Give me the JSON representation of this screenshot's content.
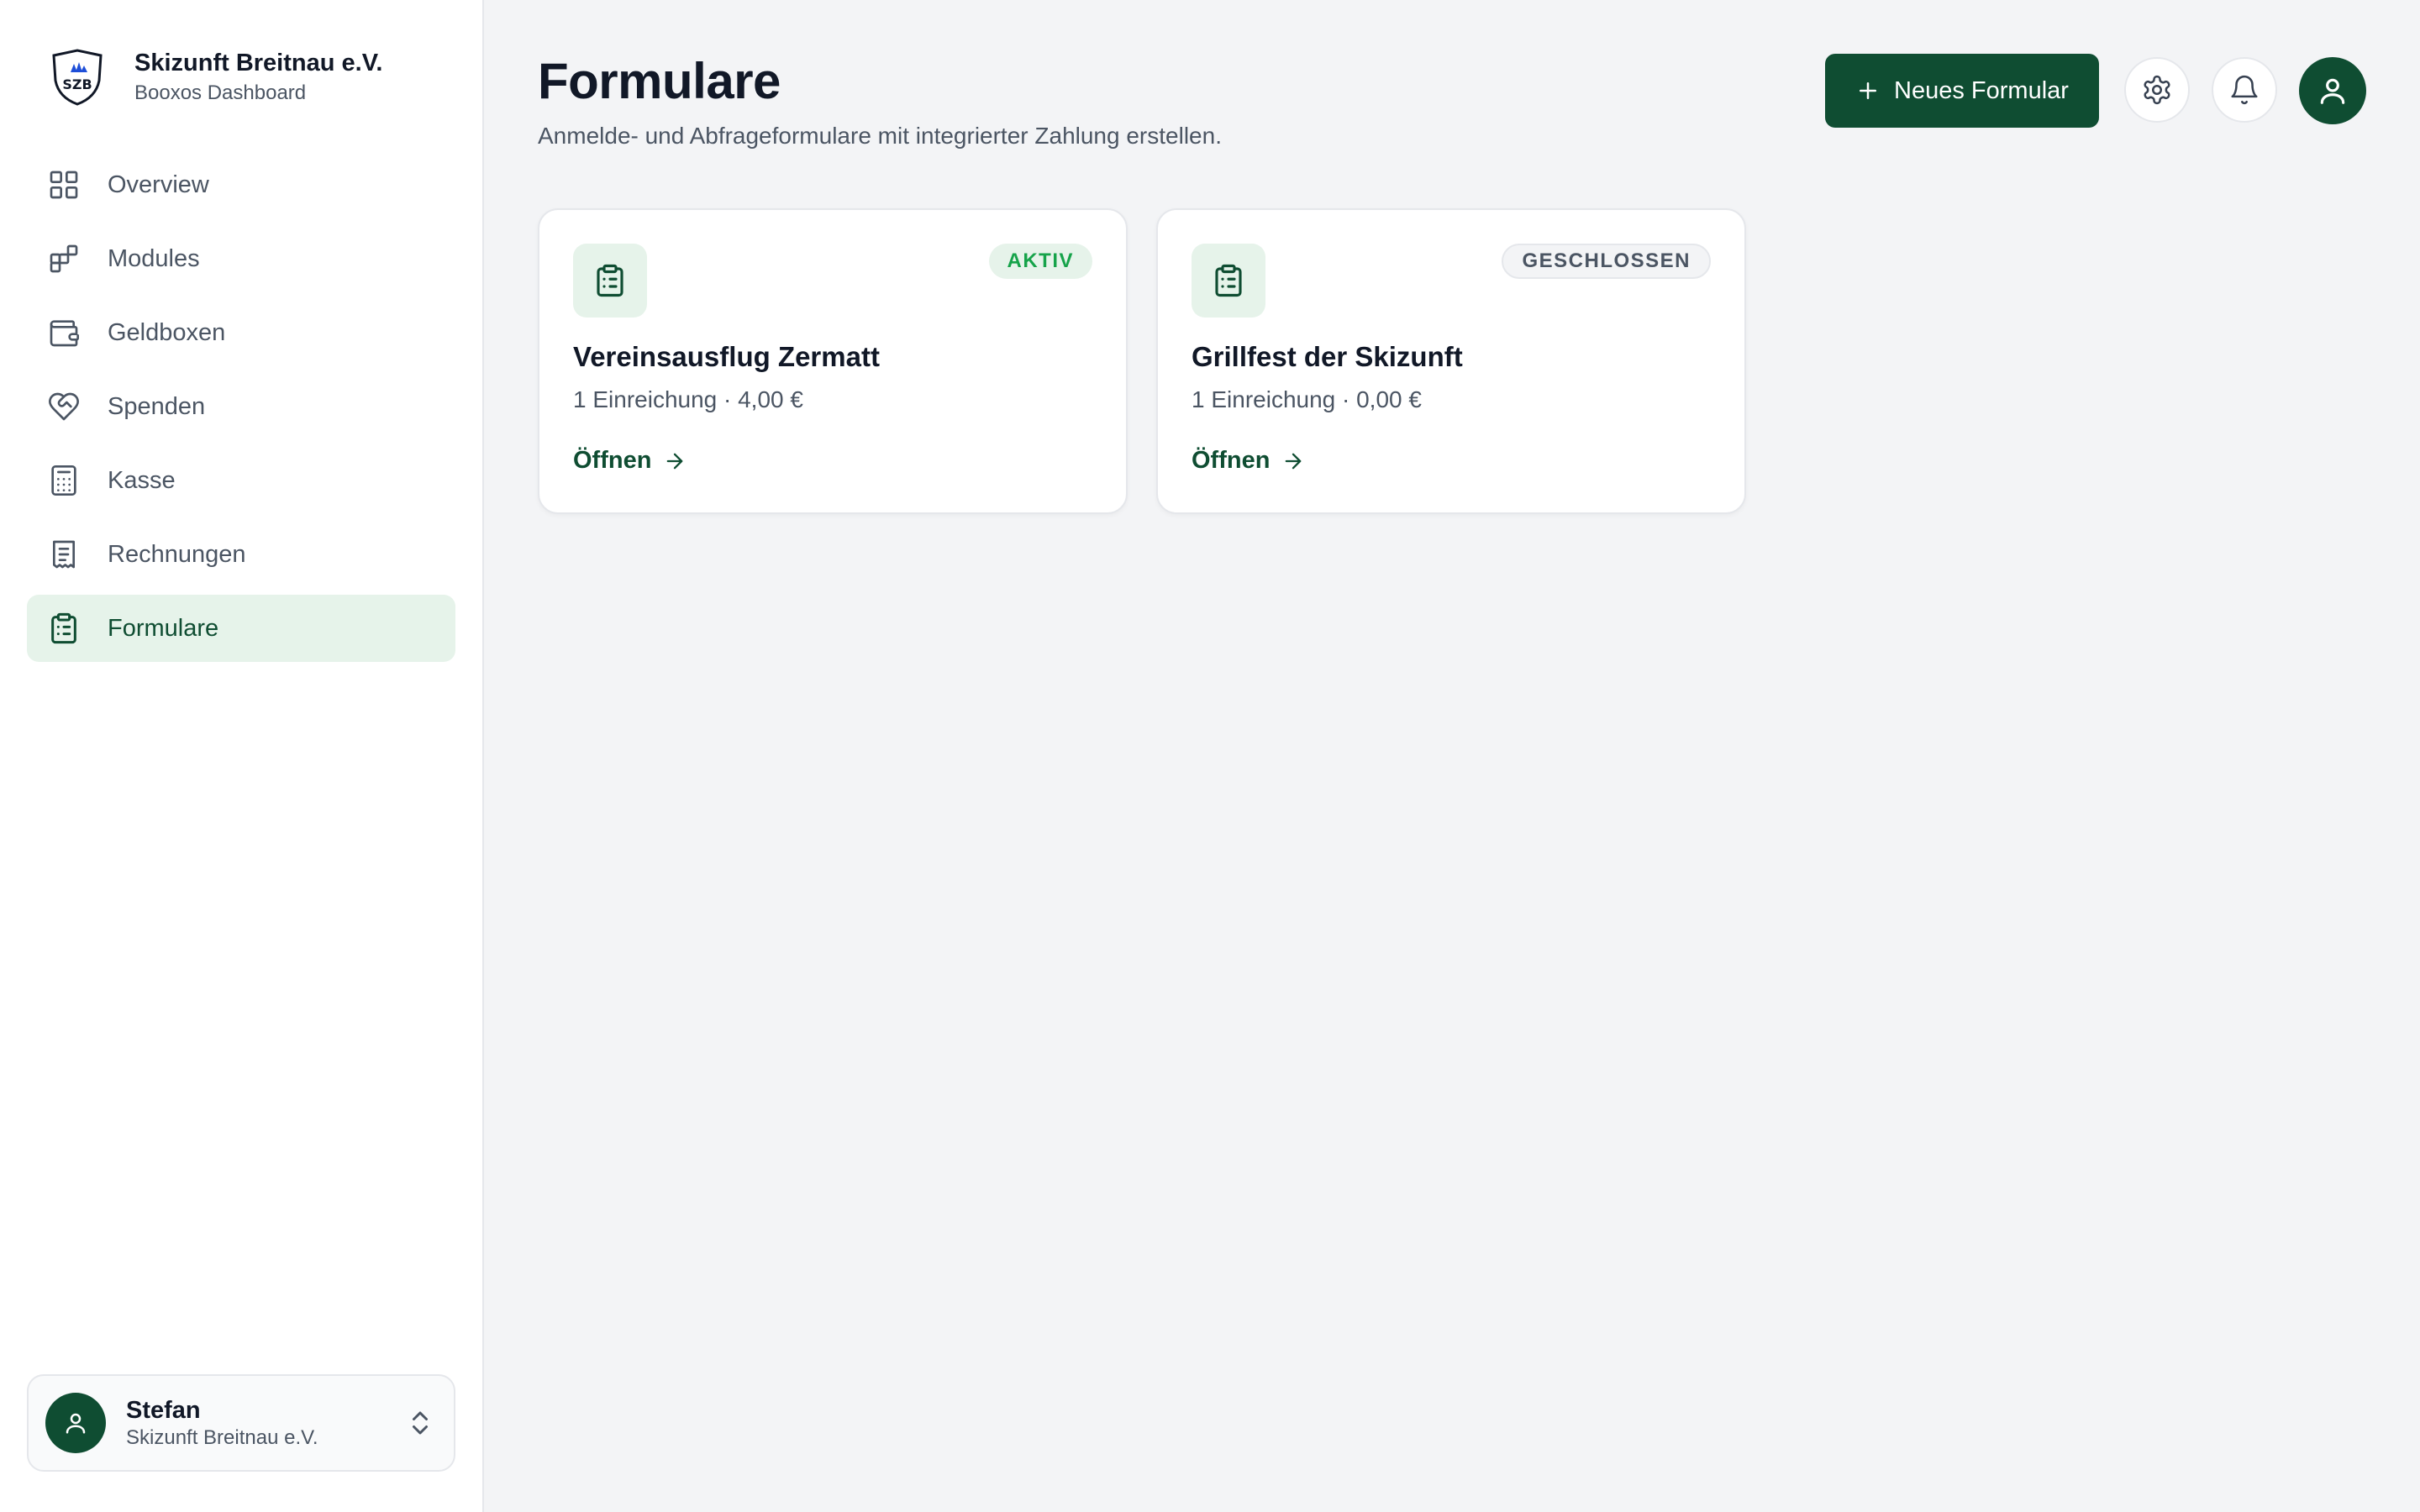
{
  "colors": {
    "brand_green": "#0f4d32",
    "active_nav_bg": "#e6f3ea",
    "badge_active": "#16a34a",
    "page_bg": "#f3f4f6"
  },
  "org": {
    "name": "Skizunft Breitnau e.V.",
    "subtitle": "Booxos Dashboard",
    "logo_text": "SZB"
  },
  "sidebar": {
    "items": [
      {
        "label": "Overview",
        "icon": "grid-icon"
      },
      {
        "label": "Modules",
        "icon": "modules-icon"
      },
      {
        "label": "Geldboxen",
        "icon": "wallet-icon"
      },
      {
        "label": "Spenden",
        "icon": "heart-handshake-icon"
      },
      {
        "label": "Kasse",
        "icon": "calculator-icon"
      },
      {
        "label": "Rechnungen",
        "icon": "receipt-icon"
      },
      {
        "label": "Formulare",
        "icon": "clipboard-icon",
        "active": true
      }
    ]
  },
  "user": {
    "name": "Stefan",
    "org": "Skizunft Breitnau e.V."
  },
  "header": {
    "title": "Formulare",
    "subtitle": "Anmelde- und Abfrageformulare mit integrierter Zahlung erstellen.",
    "new_button": "Neues Formular"
  },
  "forms": [
    {
      "title": "Vereinsausflug Zermatt",
      "meta": "1 Einreichung · 4,00 €",
      "status": "AKTIV",
      "link": "Öffnen"
    },
    {
      "title": "Grillfest der Skizunft",
      "meta": "1 Einreichung · 0,00 €",
      "status": "GESCHLOSSEN",
      "link": "Öffnen"
    }
  ]
}
